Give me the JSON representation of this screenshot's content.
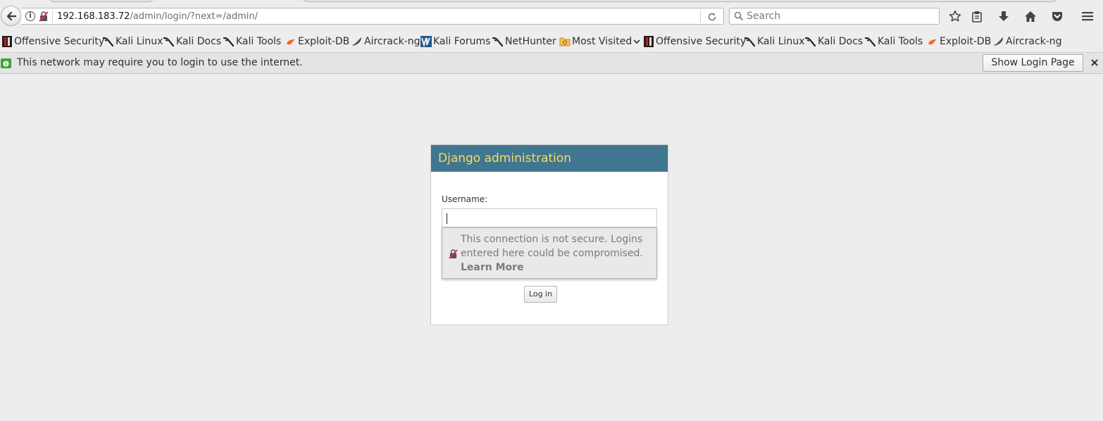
{
  "browser": {
    "url_host": "192.168.183.72",
    "url_path": "/admin/login/?next=/admin/",
    "search_placeholder": "Search",
    "bookmarks": [
      {
        "label": "Offensive Security",
        "icon": "offsec-icon"
      },
      {
        "label": "Kali Linux",
        "icon": "kali-dragon-icon"
      },
      {
        "label": "Kali Docs",
        "icon": "kali-dragon-icon"
      },
      {
        "label": "Kali Tools",
        "icon": "kali-dragon-icon"
      },
      {
        "label": "Exploit-DB",
        "icon": "exploitdb-icon"
      },
      {
        "label": "Aircrack-ng",
        "icon": "aircrack-icon"
      },
      {
        "label": "Kali Forums",
        "icon": "kali-forums-icon"
      },
      {
        "label": "NetHunter",
        "icon": "kali-dragon-icon"
      },
      {
        "label": "Most Visited",
        "icon": "folder-icon"
      },
      {
        "label": "Offensive Security",
        "icon": "offsec-icon"
      },
      {
        "label": "Kali Linux",
        "icon": "kali-dragon-icon"
      },
      {
        "label": "Kali Docs",
        "icon": "kali-dragon-icon"
      },
      {
        "label": "Kali Tools",
        "icon": "kali-dragon-icon"
      },
      {
        "label": "Exploit-DB",
        "icon": "exploitdb-icon"
      },
      {
        "label": "Aircrack-ng",
        "icon": "aircrack-icon"
      }
    ]
  },
  "notification": {
    "text": "This network may require you to login to use the internet.",
    "button_label": "Show Login Page"
  },
  "page": {
    "header_title": "Django administration",
    "username_label": "Username:",
    "username_value": "",
    "insecure_warning": "This connection is not secure. Logins entered here could be compromised.",
    "learn_more": "Learn More",
    "login_button": "Log in"
  },
  "colors": {
    "header_bg": "#417690",
    "header_text": "#f5dd5d",
    "page_bg": "#ededed",
    "notice_icon": "#3aa537"
  }
}
